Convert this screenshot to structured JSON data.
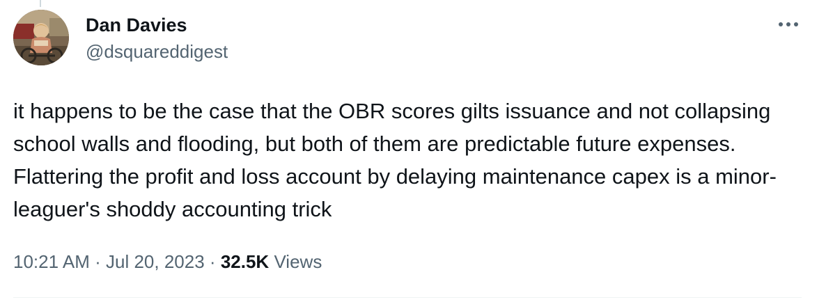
{
  "tweet": {
    "author": {
      "display_name": "Dan Davies",
      "handle": "@dsquareddigest"
    },
    "text": "it happens to be the case that the OBR scores gilts issuance and not collapsing school walls and flooding, but both of them are predictable future expenses. Flattering the profit and loss account by delaying maintenance capex is a minor-leaguer's shoddy accounting trick",
    "time": "10:21 AM",
    "date": "Jul 20, 2023",
    "separator": "·",
    "views_count": "32.5K",
    "views_label": "Views"
  },
  "icons": {
    "more": "more-horizontal-icon",
    "avatar": "profile-photo"
  },
  "colors": {
    "text_primary": "#0f1419",
    "text_secondary": "#536471",
    "divider": "#eff3f4"
  }
}
